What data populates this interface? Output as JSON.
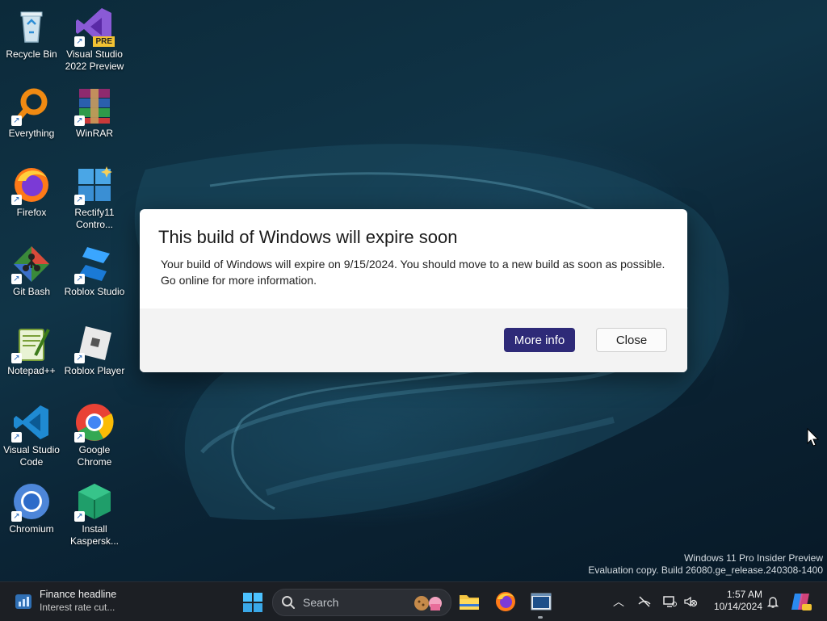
{
  "desktop": {
    "icons": [
      {
        "label": "Recycle Bin",
        "icon": "recycle-bin-icon"
      },
      {
        "label": "Visual Studio 2022 Preview",
        "icon": "visual-studio-preview-icon",
        "badge": "PRE"
      },
      {
        "label": "Everything",
        "icon": "everything-search-icon"
      },
      {
        "label": "WinRAR",
        "icon": "winrar-icon"
      },
      {
        "label": "Firefox",
        "icon": "firefox-icon"
      },
      {
        "label": "Rectify11 Contro...",
        "icon": "rectify11-icon"
      },
      {
        "label": "Git Bash",
        "icon": "git-bash-icon"
      },
      {
        "label": "Roblox Studio",
        "icon": "roblox-studio-icon"
      },
      {
        "label": "Notepad++",
        "icon": "notepad-plus-plus-icon"
      },
      {
        "label": "Roblox Player",
        "icon": "roblox-player-icon"
      },
      {
        "label": "Visual Studio Code",
        "icon": "vscode-icon"
      },
      {
        "label": "Google Chrome",
        "icon": "chrome-icon"
      },
      {
        "label": "Chromium",
        "icon": "chromium-icon"
      },
      {
        "label": "Install Kaspersk...",
        "icon": "kaspersky-icon"
      }
    ]
  },
  "dialog": {
    "title": "This build of Windows will expire soon",
    "body": "Your build of Windows will expire on 9/15/2024. You should move to a new build as soon as possible. Go online for more information.",
    "primary_button": "More info",
    "secondary_button": "Close",
    "accent_color": "#2e2a78"
  },
  "watermark": {
    "line1": "Windows 11 Pro Insider Preview",
    "line2": "Evaluation copy. Build 26080.ge_release.240308-1400"
  },
  "taskbar": {
    "widget": {
      "title": "Finance headline",
      "subtitle": "Interest rate cut..."
    },
    "search_placeholder": "Search",
    "pinned": [
      "file-explorer-icon",
      "firefox-icon",
      "active-window-icon"
    ],
    "clock": {
      "time": "1:57 AM",
      "date": "10/14/2024"
    },
    "tray": [
      "chevron-up-icon",
      "network-off-icon",
      "display-icon",
      "volume-muted-icon",
      "notification-bell-icon",
      "copilot-icon"
    ]
  }
}
